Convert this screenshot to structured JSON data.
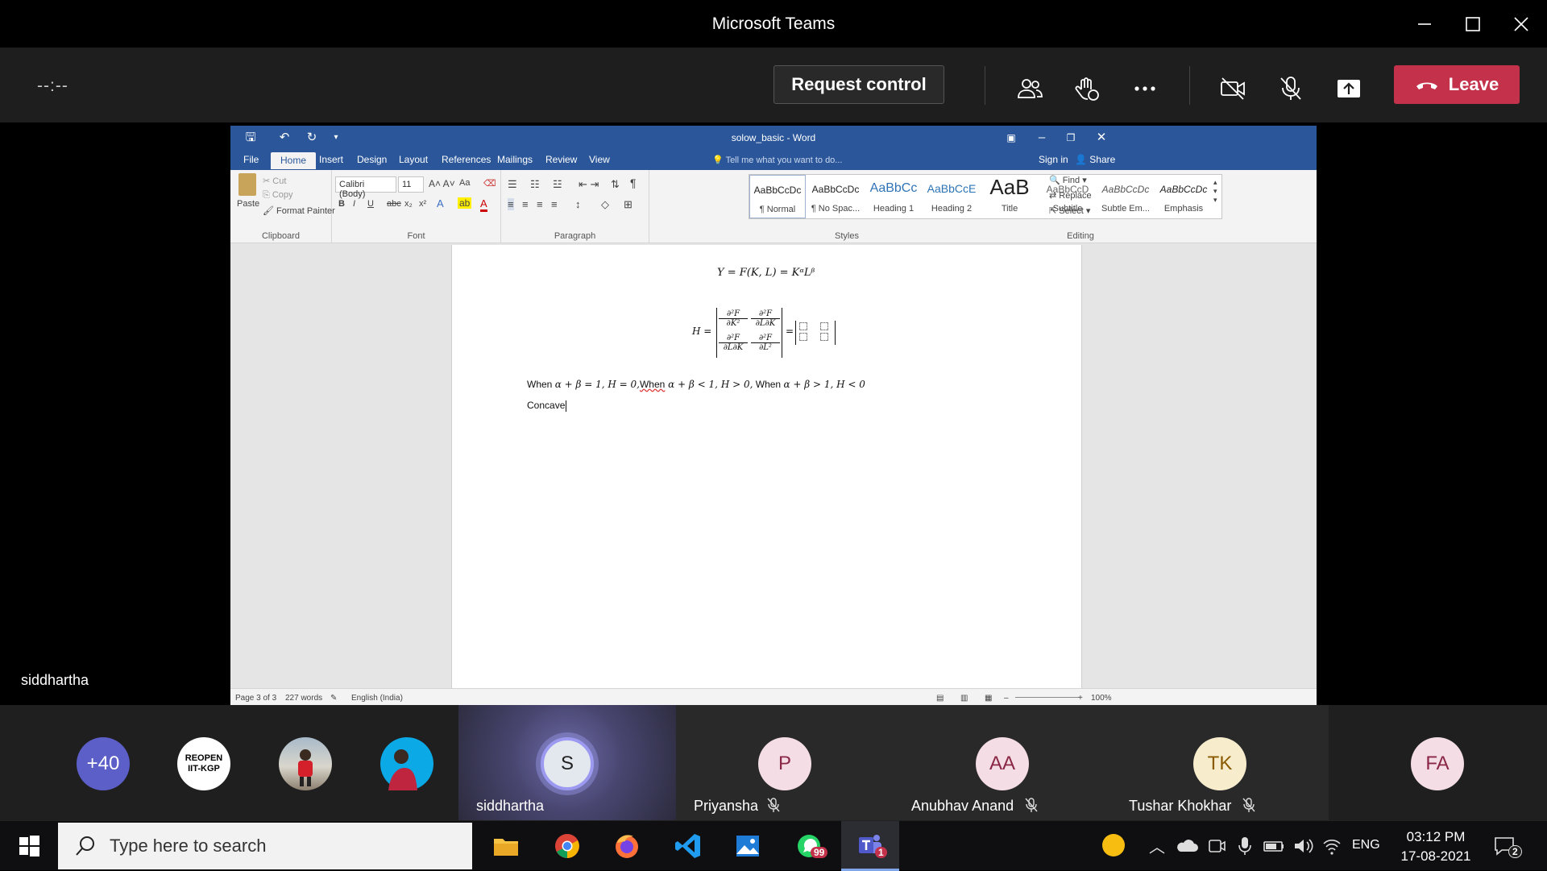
{
  "window": {
    "title": "Microsoft Teams"
  },
  "meeting": {
    "timer": "--:--",
    "request_control_label": "Request control",
    "leave_label": "Leave",
    "presenter_name": "siddhartha"
  },
  "word": {
    "doc_title": "solow_basic - Word",
    "tabs": [
      "File",
      "Home",
      "Insert",
      "Design",
      "Layout",
      "References",
      "Mailings",
      "Review",
      "View"
    ],
    "tell_me": "Tell me what you want to do...",
    "sign_in": "Sign in",
    "share": "Share",
    "clipboard": {
      "paste": "Paste",
      "cut": "Cut",
      "copy": "Copy",
      "format_painter": "Format Painter",
      "group": "Clipboard"
    },
    "font": {
      "name": "Calibri (Body)",
      "size": "11",
      "group": "Font",
      "case": "Aa"
    },
    "paragraph": {
      "group": "Paragraph"
    },
    "styles": {
      "group": "Styles",
      "items": [
        {
          "preview": "AaBbCcDc",
          "name": "¶ Normal"
        },
        {
          "preview": "AaBbCcDc",
          "name": "¶ No Spac..."
        },
        {
          "preview": "AaBbCc",
          "name": "Heading 1"
        },
        {
          "preview": "AaBbCcE",
          "name": "Heading 2"
        },
        {
          "preview": "AaB",
          "name": "Title"
        },
        {
          "preview": "AaBbCcD",
          "name": "Subtitle"
        },
        {
          "preview": "AaBbCcDc",
          "name": "Subtle Em..."
        },
        {
          "preview": "AaBbCcDc",
          "name": "Emphasis"
        }
      ]
    },
    "editing": {
      "find": "Find",
      "replace": "Replace",
      "select": "Select",
      "group": "Editing"
    },
    "document": {
      "eq1": "Y = F(K, L) = KᵅLᵝ",
      "h_label": "H =",
      "matrix": [
        "∂²F",
        "∂K²",
        "∂²F",
        "∂L∂K",
        "∂²F",
        "∂L∂K",
        "∂²F",
        "∂L²"
      ],
      "equals": "=",
      "line1_a": "When ",
      "line1_b": "α + β = 1, H = 0,",
      "line1_c": "When",
      "line1_d": " α + β < 1, H > 0,",
      "line1_e": " When ",
      "line1_f": "α + β > 1, H < 0",
      "line2": "Concave"
    },
    "status": {
      "page": "Page 3 of 3",
      "words": "227 words",
      "language": "English (India)",
      "zoom": "100%"
    }
  },
  "participants": {
    "overflow": "+40",
    "reopen": "REOPEN\nIIT-KGP",
    "tiles": [
      {
        "name": "siddhartha",
        "initials": "S"
      },
      {
        "name": "Priyansha",
        "initials": "P"
      },
      {
        "name": "Anubhav Anand",
        "initials": "AA"
      },
      {
        "name": "Tushar Khokhar",
        "initials": "TK"
      },
      {
        "name": "",
        "initials": "FA"
      }
    ]
  },
  "taskbar": {
    "search_placeholder": "Type here to search",
    "whatsapp_badge": "99",
    "teams_badge": "1",
    "language": "ENG",
    "time": "03:12 PM",
    "date": "17-08-2021",
    "notifications": "2"
  },
  "colors": {
    "leave": "#c4314b",
    "word_blue": "#2b579a",
    "accent": "#6264a7"
  }
}
